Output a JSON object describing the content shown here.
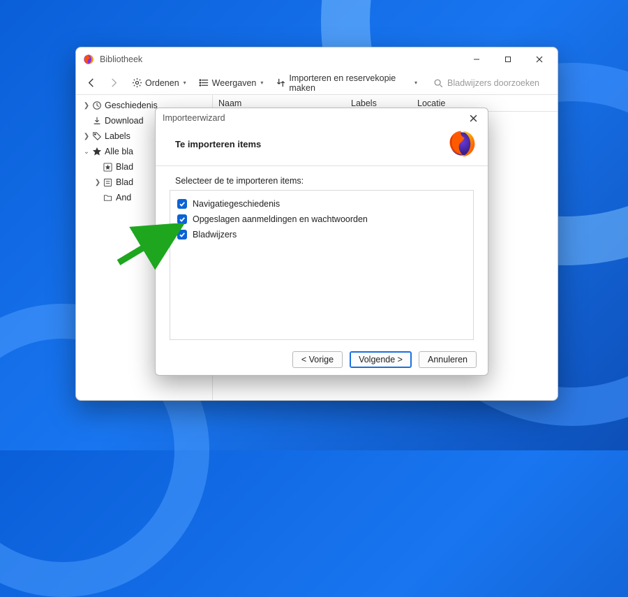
{
  "library": {
    "title": "Bibliotheek",
    "toolbar": {
      "organize": "Ordenen",
      "views": "Weergaven",
      "import": "Importeren en reservekopie maken"
    },
    "search_placeholder": "Bladwijzers doorzoeken",
    "columns": {
      "name": "Naam",
      "labels": "Labels",
      "location": "Locatie"
    },
    "tree": {
      "history": "Geschiedenis",
      "downloads": "Download",
      "labels": "Labels",
      "all_bookmarks": "Alle bla",
      "child_blad1": "Blad",
      "child_blad2": "Blad",
      "child_and": "And"
    }
  },
  "wizard": {
    "window_title": "Importeerwizard",
    "heading": "Te importeren items",
    "prompt": "Selecteer de te importeren items:",
    "items": {
      "history": "Navigatiegeschiedenis",
      "logins": "Opgeslagen aanmeldingen en wachtwoorden",
      "bookmarks": "Bladwijzers"
    },
    "buttons": {
      "back": "< Vorige",
      "next": "Volgende >",
      "cancel": "Annuleren"
    }
  }
}
